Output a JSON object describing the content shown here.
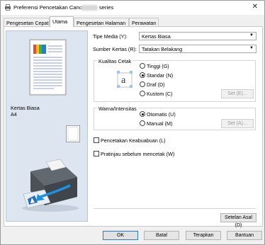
{
  "window": {
    "title_prefix": "Preferensi Pencetakan Canon",
    "title_suffix": "series"
  },
  "tabs": [
    {
      "label": "Pengesetan Cepat"
    },
    {
      "label": "Utama"
    },
    {
      "label": "Pengesetan Halaman"
    },
    {
      "label": "Perawatan"
    }
  ],
  "preview": {
    "media_label": "Kertas Biasa",
    "size_label": "A4"
  },
  "form": {
    "media_type_label": "Tipe Media (Y):",
    "media_type_value": "Kertas Biasa",
    "paper_source_label": "Sumber Kertas (R):",
    "paper_source_value": "Tatakan Belakang",
    "print_quality_title": "Kualitas Cetak",
    "quality_options": [
      "Tinggi (G)",
      "Standar (N)",
      "Draf (D)",
      "Kustom (C)"
    ],
    "quality_set_button": "Set (E)...",
    "color_title": "Warna/Intensitas",
    "color_options": [
      "Otomatis (U)",
      "Manual (M)"
    ],
    "color_set_button": "Set (A)...",
    "grayscale_label": "Pencetakan Keabuabuan (L)",
    "preview_label": "Pratinjau sebelum mencetak (W)",
    "defaults_button": "Setelan Asal (D)"
  },
  "footer": {
    "ok": "OK",
    "cancel": "Batal",
    "apply": "Terapkan",
    "help": "Bantuan"
  },
  "colors": {
    "accent": "#2b78d6"
  }
}
